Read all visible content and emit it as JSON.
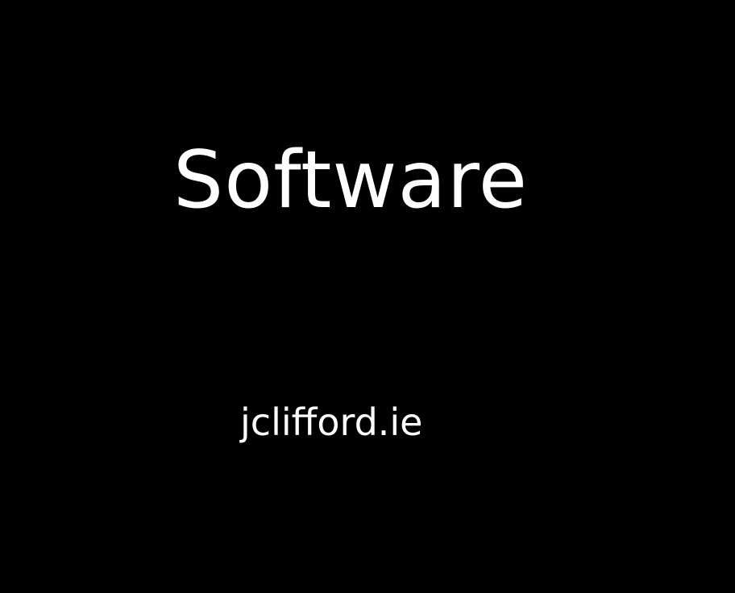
{
  "title": "Software",
  "website": "jclifford.ie",
  "colors": {
    "background": "#000000",
    "text": "#ffffff"
  }
}
